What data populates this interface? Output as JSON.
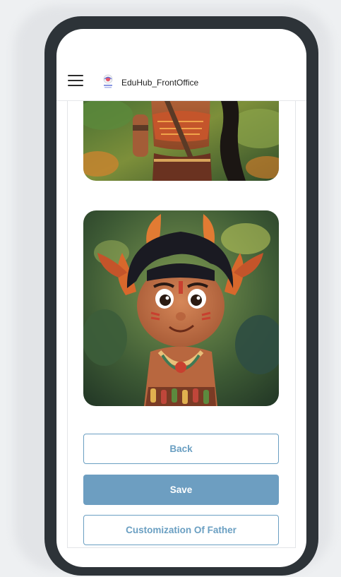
{
  "header": {
    "title": "EduHub_FrontOffice",
    "menu_icon": "hamburger-menu-icon",
    "logo_icon": "eduhub-logo-icon"
  },
  "gallery": {
    "items": [
      {
        "image": "tribal-girl-character-illustration"
      },
      {
        "image": "tribal-boy-character-illustration"
      }
    ]
  },
  "actions": {
    "back_label": "Back",
    "save_label": "Save",
    "customize_label": "Customization Of Father"
  },
  "colors": {
    "accent": "#6d9ec1",
    "frame": "#2d3338"
  }
}
